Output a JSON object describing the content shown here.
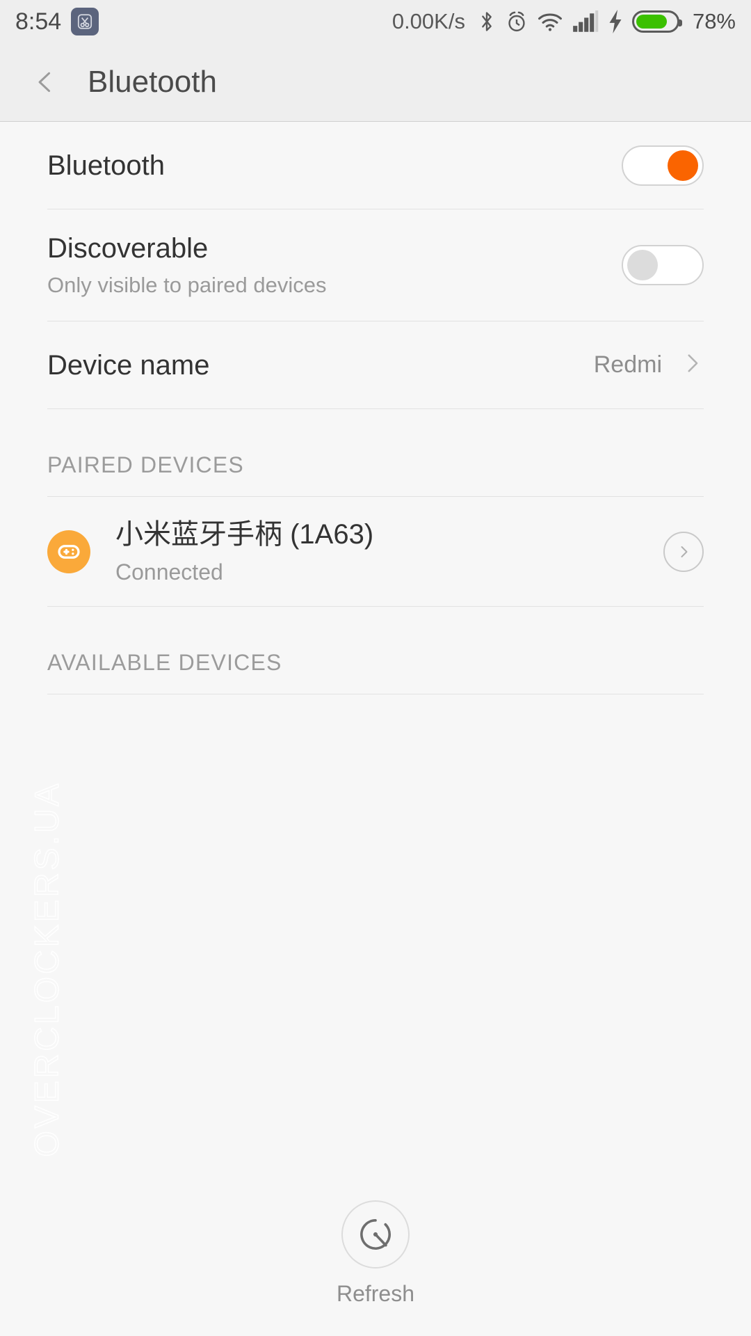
{
  "status_bar": {
    "time": "8:54",
    "screenshot_icon": "scissors-icon",
    "network_speed": "0.00K/s",
    "icons": [
      "bluetooth-icon",
      "alarm-icon",
      "wifi-icon",
      "signal-icon",
      "charging-bolt-icon"
    ],
    "battery_percent": "78%",
    "battery_level": 78,
    "battery_color": "#3bc000",
    "background": "#eeeeee"
  },
  "app_bar": {
    "back_label": "back-chevron",
    "title": "Bluetooth"
  },
  "settings": {
    "bluetooth": {
      "title": "Bluetooth",
      "toggle_state": "on",
      "accent_color": "#fa6400"
    },
    "discoverable": {
      "title": "Discoverable",
      "subtitle": "Only visible to paired devices",
      "toggle_state": "off"
    },
    "device_name": {
      "title": "Device name",
      "value": "Redmi"
    }
  },
  "paired_section": {
    "label": "PAIRED DEVICES",
    "devices": [
      {
        "name": "小米蓝牙手柄 (1A63)",
        "status": "Connected",
        "icon": "gamepad-icon",
        "icon_color": "#faa93a"
      }
    ]
  },
  "available_section": {
    "label": "AVAILABLE DEVICES",
    "devices": []
  },
  "refresh": {
    "label": "Refresh",
    "icon": "scan-radar-icon"
  },
  "watermark": {
    "text": "OVERCLOCKERS.UA"
  }
}
